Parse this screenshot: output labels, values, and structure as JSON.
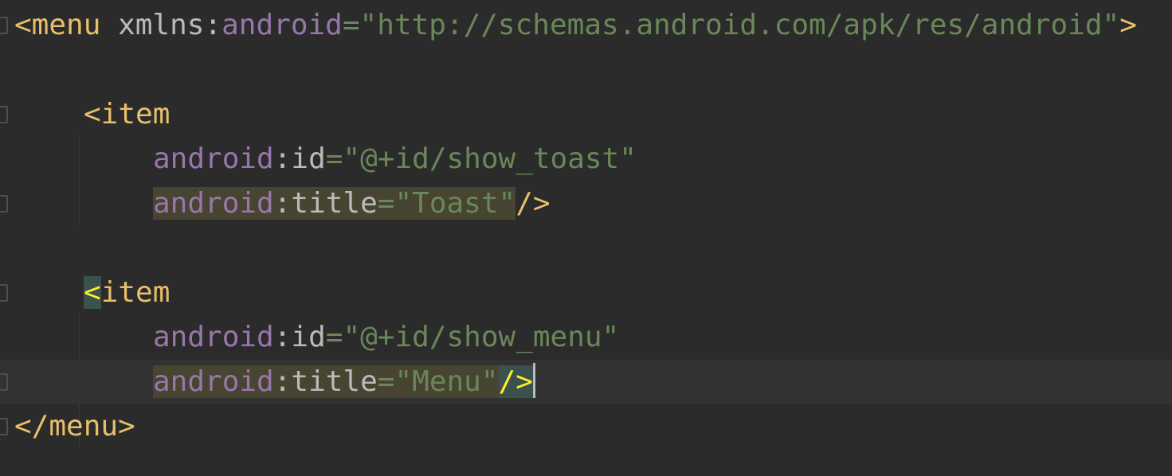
{
  "editor": {
    "language": "XML",
    "colors": {
      "background": "#2b2b2b",
      "current_line": "#323232",
      "tag": "#e8bf6a",
      "attribute_namespace": "#9876aa",
      "attribute_name": "#bababa",
      "string": "#6a8759",
      "highlight_attr": "#474431",
      "brace_match": "#3b514d"
    },
    "gutter_icon": "fold-marker-icon",
    "lines": [
      {
        "open": "<menu",
        "sp": " ",
        "attr": "xmlns",
        "colon": ":",
        "ns": "android",
        "eq": "=",
        "value": "\"http://schemas.android.com/apk/res/android\"",
        "close": ">"
      },
      {
        "open": "<item"
      },
      {
        "ns": "android",
        "colon": ":",
        "attr": "id",
        "eq": "=",
        "value": "\"@+id/show_toast\""
      },
      {
        "ns": "android",
        "colon": ":",
        "attr": "title",
        "eq": "=",
        "value": "\"Toast\"",
        "close": "/>"
      },
      {
        "bracket": "<",
        "name": "item"
      },
      {
        "ns": "android",
        "colon": ":",
        "attr": "id",
        "eq": "=",
        "value": "\"@+id/show_menu\""
      },
      {
        "ns": "android",
        "colon": ":",
        "attr": "title",
        "eq": "=",
        "value": "\"Menu\"",
        "close": "/>"
      },
      {
        "close": "</menu>"
      }
    ]
  }
}
